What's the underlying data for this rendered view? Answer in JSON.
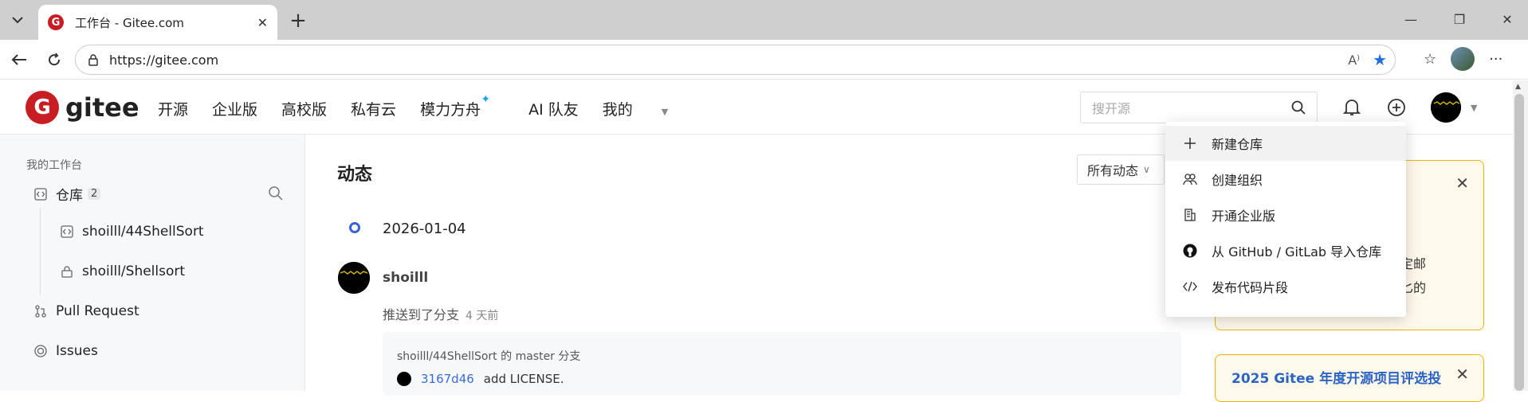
{
  "browser": {
    "tab_title": "工作台 - Gitee.com",
    "url": "https://gitee.com"
  },
  "nav": {
    "logo_text": "gitee",
    "menu": [
      "开源",
      "企业版",
      "高校版",
      "私有云",
      "模力方舟",
      "AI 队友",
      "我的"
    ],
    "search_placeholder": "搜开源"
  },
  "sidebar": {
    "title": "我的工作台",
    "repos_label": "仓库",
    "repos_count": "2",
    "repo1": "shoilll/44ShellSort",
    "repo2": "shoilll/Shellsort",
    "pr": "Pull Request",
    "issues": "Issues"
  },
  "main": {
    "heading": "动态",
    "filter": "所有动态",
    "date": "2026-01-04",
    "user": "shoilll",
    "action": "推送到了分支",
    "time_ago": "4 天前",
    "card_line1": "shoilll/44ShellSort 的 master 分支",
    "commit_sha": "3167d46",
    "commit_msg": "add LICENSE."
  },
  "dropdown": {
    "items": [
      "新建仓库",
      "创建组织",
      "开通企业版",
      "从 GitHub / GitLab 导入仓库",
      "发布代码片段"
    ]
  },
  "right": {
    "card1_text1": "定邮",
    "card1_text2": "匕的",
    "card2_title": "2025 Gitee 年度开源项目评选投"
  },
  "colors": {
    "brand": "#c71d23",
    "link": "#3b6ad8",
    "notice_border": "#f0b400"
  }
}
